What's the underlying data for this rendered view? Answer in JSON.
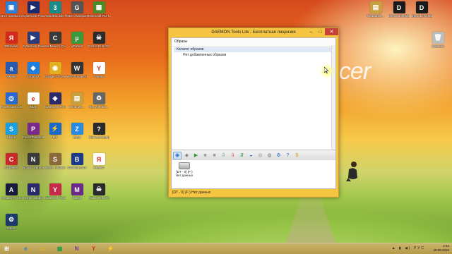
{
  "desktop": {
    "brand_text": "acer",
    "icons_left": [
      {
        "label": "Этот компьютер",
        "color": "#2d7fd6",
        "glyph": "▣"
      },
      {
        "label": "CyberLink Power Med...",
        "color": "#1b2b6e",
        "glyph": "▶"
      },
      {
        "label": "Autodesk 3ds Max 2010 3...",
        "color": "#1d8a8a",
        "glyph": "3"
      },
      {
        "label": "GEO Autosport...",
        "color": "#555555",
        "glyph": "G"
      },
      {
        "label": "Minecraft RU-M.org",
        "color": "#4d8a2a",
        "glyph": "▦"
      },
      {
        "label": "ЯBrowser",
        "color": "#d42a1e",
        "glyph": "Я"
      },
      {
        "label": "CyberLink PowerDirec...",
        "color": "#2a3a7a",
        "glyph": "▶"
      },
      {
        "label": "Sid Meier's Civilization...",
        "color": "#3a3a3a",
        "glyph": "C"
      },
      {
        "label": "uTorrent",
        "color": "#3a9a3a",
        "glyph": "µ"
      },
      {
        "label": "Call of Duty Ghosts",
        "color": "#2a2a2a",
        "glyph": "☠"
      },
      {
        "label": "aiMate",
        "color": "#2a5ab0",
        "glyph": "a"
      },
      {
        "label": "Dropbox",
        "color": "#1f7fe0",
        "glyph": "◆"
      },
      {
        "label": "Google Chrome",
        "color": "#e0b020",
        "glyph": "◉"
      },
      {
        "label": "WarThunder III",
        "color": "#333333",
        "glyph": "W"
      },
      {
        "label": "Yandex",
        "color": "#ffffff",
        "glyph": "Y"
      },
      {
        "label": "PowerCam Center",
        "color": "#2a6ad0",
        "glyph": "◎"
      },
      {
        "label": "eBay",
        "color": "#ffffff",
        "glyph": "e"
      },
      {
        "label": "CyberLink PhotoDirec...",
        "color": "#2a2a6a",
        "glyph": "◈"
      },
      {
        "label": "Windows...",
        "color": "#c8a040",
        "glyph": "▤"
      },
      {
        "label": "Recycle Bin...",
        "color": "#666666",
        "glyph": "♻"
      },
      {
        "label": "Skype",
        "color": "#1aa0e0",
        "glyph": "S"
      },
      {
        "label": "Foxit PhantomPDF",
        "color": "#7a2a8a",
        "glyph": "P"
      },
      {
        "label": "DT",
        "color": "#1a6ac8",
        "glyph": "⚡"
      },
      {
        "label": "Zona",
        "color": "#2a8ae0",
        "glyph": "Z"
      },
      {
        "label": "Help and Support",
        "color": "#2a2a2a",
        "glyph": "?"
      },
      {
        "label": "CCleaner",
        "color": "#c82a2a",
        "glyph": "C"
      },
      {
        "label": "Nmap - Zenmap GUI",
        "color": "#3a3a3a",
        "glyph": "N"
      },
      {
        "label": "samp - Ярлык",
        "color": "#8a6a3a",
        "glyph": "S"
      },
      {
        "label": "Booking.com",
        "color": "#1a3a8a",
        "glyph": "B"
      },
      {
        "label": "Яндекс",
        "color": "#ffffff",
        "glyph": "Я"
      },
      {
        "label": "Assassin's Creed",
        "color": "#1a1a3a",
        "glyph": "A"
      },
      {
        "label": "Norton Studio",
        "color": "#2a2a6a",
        "glyph": "N"
      },
      {
        "label": "CyberLink YouCam",
        "color": "#c82a4a",
        "glyph": "Y"
      },
      {
        "label": "Media",
        "color": "#6a2a8a",
        "glyph": "M"
      },
      {
        "label": "Call of Duty Ghosts",
        "color": "#2a2a2a",
        "glyph": "☠"
      },
      {
        "label": "Steam",
        "color": "#1a3a6a",
        "glyph": "⚙"
      }
    ],
    "icons_right": [
      {
        "label": "Nedbanke...",
        "color": "#c8a040",
        "glyph": "▤"
      },
      {
        "label": "Dying Light Manual",
        "color": "#1a1a1a",
        "glyph": "D"
      },
      {
        "label": "Dying Light Manual",
        "color": "#1a1a1a",
        "glyph": "D"
      },
      {
        "label": "Корзина",
        "color": "#bcbcbc",
        "glyph": "🗑"
      }
    ]
  },
  "window": {
    "title": "DAEMON Tools Lite - Бесплатная лицензия",
    "images_header": "Образы",
    "catalog_label": "Каталог образов",
    "empty_text": "Нет добавленных образов",
    "drive_label": "[DT - 0] (F:)",
    "drive_status": "Нет данных",
    "status_bar": "[DT - 0] (F:) Нет данных",
    "toolbar": [
      "add-image",
      "add-images",
      "mount",
      "stop",
      "unmount-all",
      "grab",
      "write",
      "convert",
      "burn",
      "disc-copy",
      "settings",
      "help",
      "buy"
    ]
  },
  "taskbar": {
    "apps": [
      {
        "name": "start",
        "glyph": "⊞",
        "color": "#ffffff"
      },
      {
        "name": "ie",
        "glyph": "e",
        "color": "#2a7ad6"
      },
      {
        "name": "explorer",
        "glyph": "▭",
        "color": "#e0b030"
      },
      {
        "name": "store",
        "glyph": "▦",
        "color": "#2a9a4a"
      },
      {
        "name": "onenote",
        "glyph": "N",
        "color": "#7a3aa0"
      },
      {
        "name": "yandex",
        "glyph": "Y",
        "color": "#d42a1e"
      },
      {
        "name": "daemon",
        "glyph": "⚡",
        "color": "#3a7ad6"
      }
    ],
    "lang": "РУС",
    "time": "2:54",
    "date": "29.08.2015"
  }
}
